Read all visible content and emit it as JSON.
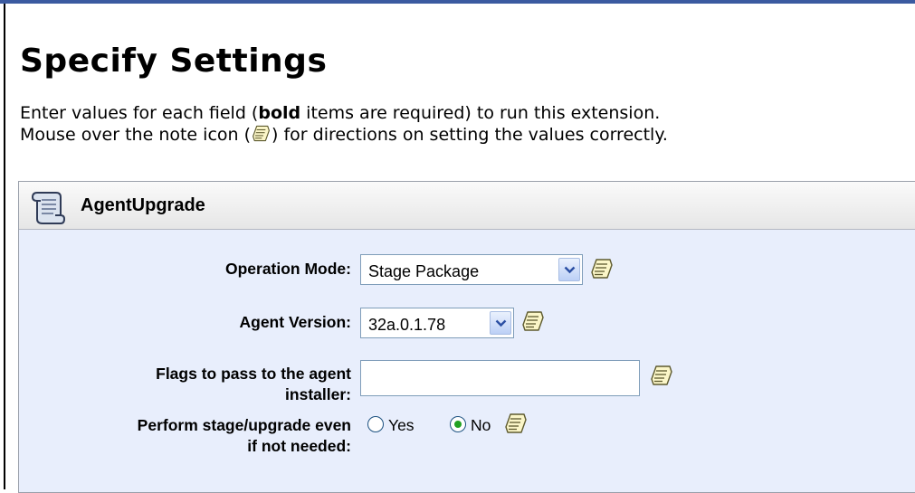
{
  "page": {
    "title": "Specify Settings",
    "instructions": {
      "line1_before": "Enter values for each field (",
      "line1_bold": "bold",
      "line1_after": " items are required) to run this extension.",
      "line2_before": "Mouse over the note icon (",
      "line2_after": ") for directions on setting the values correctly."
    }
  },
  "panel": {
    "title": "AgentUpgrade",
    "icon": "scroll-icon"
  },
  "fields": {
    "operation_mode": {
      "label": "Operation Mode:",
      "value": "Stage Package"
    },
    "agent_version": {
      "label": "Agent Version:",
      "value": "32a.0.1.78"
    },
    "flags": {
      "label_line1": "Flags to pass to the agent",
      "label_line2": "installer:",
      "value": "",
      "placeholder": ""
    },
    "perform_stage": {
      "label_line1": "Perform stage/upgrade even",
      "label_line2": "if not needed:",
      "options": [
        "Yes",
        "No"
      ],
      "selected": "No"
    }
  },
  "icons": {
    "note": "note-icon",
    "dropdown": "chevron-down-icon"
  },
  "colors": {
    "top_bar": "#3b5aa0",
    "panel_background": "#e8eefc",
    "input_border": "#7f9db9",
    "radio_selected": "#21a121"
  }
}
